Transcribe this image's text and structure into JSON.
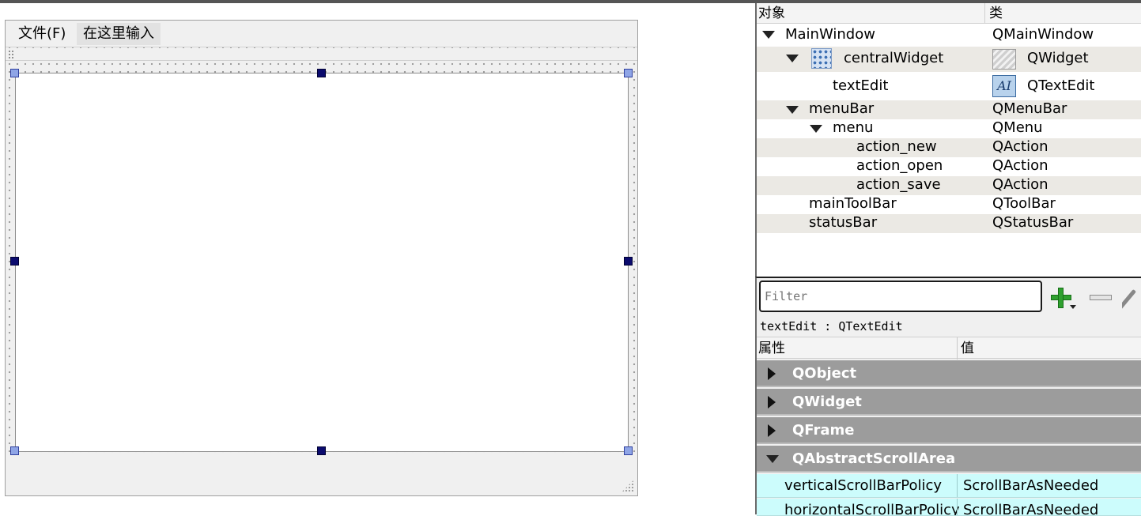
{
  "form": {
    "menubar": {
      "items": [
        {
          "label": "文件(F)"
        },
        {
          "label": "在这里输入"
        }
      ]
    }
  },
  "object_inspector": {
    "columns": {
      "object": "对象",
      "class": "类"
    },
    "rows": [
      {
        "name": "MainWindow",
        "class": "QMainWindow",
        "expanded": true
      },
      {
        "name": "centralWidget",
        "class": "QWidget",
        "icon": "grid-layout-icon",
        "class_icon": "widget-icon",
        "expanded": true
      },
      {
        "name": "textEdit",
        "class": "QTextEdit",
        "class_icon": "textedit-icon"
      },
      {
        "name": "menuBar",
        "class": "QMenuBar",
        "expanded": true
      },
      {
        "name": "menu",
        "class": "QMenu",
        "expanded": true
      },
      {
        "name": "action_new",
        "class": "QAction"
      },
      {
        "name": "action_open",
        "class": "QAction"
      },
      {
        "name": "action_save",
        "class": "QAction"
      },
      {
        "name": "mainToolBar",
        "class": "QToolBar"
      },
      {
        "name": "statusBar",
        "class": "QStatusBar"
      }
    ]
  },
  "property_editor": {
    "filter_placeholder": "Filter",
    "object_label": "textEdit : QTextEdit",
    "columns": {
      "property": "属性",
      "value": "值"
    },
    "groups": [
      {
        "label": "QObject",
        "expanded": false
      },
      {
        "label": "QWidget",
        "expanded": false
      },
      {
        "label": "QFrame",
        "expanded": false
      },
      {
        "label": "QAbstractScrollArea",
        "expanded": true
      }
    ],
    "properties": [
      {
        "name": "verticalScrollBarPolicy",
        "value": "ScrollBarAsNeeded"
      },
      {
        "name": "horizontalScrollBarPolicy",
        "value": "ScrollBarAsNeeded"
      }
    ],
    "textedit_icon_glyph": "AI"
  }
}
